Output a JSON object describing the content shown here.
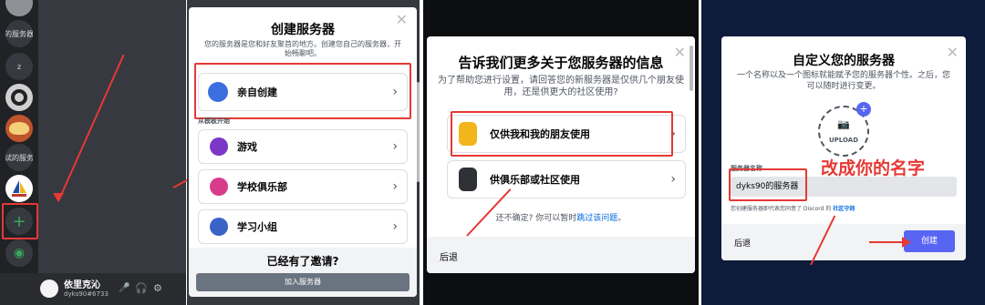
{
  "panel1": {
    "server_labels": [
      "的服务器",
      "z",
      "试的服务"
    ],
    "user": {
      "name": "依里克沁",
      "tag": "dyks90#6733"
    }
  },
  "panel2": {
    "title": "创建服务器",
    "subtitle": "您的服务器是您和好友聚首的地方。创建您自己的服务器，开始畅聊吧。",
    "first_option": "亲自创建",
    "template_header": "从模板开始",
    "options": [
      "游戏",
      "学校俱乐部",
      "学习小组"
    ],
    "invite_title": "已经有了邀请?",
    "join_button": "加入服务器"
  },
  "panel3": {
    "title": "告诉我们更多关于您服务器的信息",
    "subtitle": "为了帮助您进行设置，请回答您的新服务器是仅供几个朋友使用，还是供更大的社区使用?",
    "option_friends": "仅供我和我的朋友使用",
    "option_community": "供俱乐部或社区使用",
    "unsure_text": "还不确定? 你可以暂时",
    "skip_link": "跳过该问题",
    "back_button": "后退"
  },
  "panel4": {
    "title": "自定义您的服务器",
    "subtitle": "一个名称以及一个图标就能赋予您的服务器个性。之后，您可以随时进行变更。",
    "upload_label": "UPLOAD",
    "field_label": "服务器名称",
    "server_name_value": "dyks90的服务器",
    "annotation": "改成你的名字",
    "guideline_text": "您创建服务器即代表您同意了 Discord 的",
    "guideline_link": "社区守则",
    "back_button": "后退",
    "create_button": "创建"
  },
  "colors": {
    "annotation_red": "#e53935",
    "blurple": "#5865f2",
    "green": "#3ba55d"
  }
}
